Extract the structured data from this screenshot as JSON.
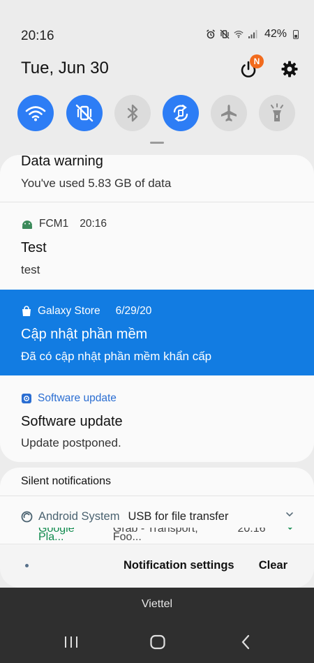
{
  "status_bar": {
    "time": "20:16",
    "battery": "42%",
    "icons": [
      "alarm-icon",
      "vibrate-icon",
      "wifi-signal-icon",
      "cell-signal-icon",
      "battery-icon"
    ]
  },
  "header": {
    "date": "Tue, Jun 30",
    "power_badge": "N"
  },
  "quick_toggles": [
    {
      "name": "wifi-icon",
      "state": "on"
    },
    {
      "name": "vibrate-icon",
      "state": "on"
    },
    {
      "name": "bluetooth-icon",
      "state": "off"
    },
    {
      "name": "auto-rotate-icon",
      "state": "on"
    },
    {
      "name": "airplane-icon",
      "state": "off"
    },
    {
      "name": "flashlight-icon",
      "state": "off"
    }
  ],
  "notifications": {
    "data_warning": {
      "title": "Data warning",
      "body": "You've used 5.83 GB of data"
    },
    "fcm": {
      "app": "FCM1",
      "time": "20:16",
      "title": "Test",
      "body": "test"
    },
    "galaxy_store": {
      "app": "Galaxy Store",
      "time": "6/29/20",
      "title": "Cập nhật phần mềm",
      "body": "Đã có cập nhật phần mềm khẩn cấp"
    },
    "software_update": {
      "app": "Software update",
      "title": "Software update",
      "body": "Update postponed."
    }
  },
  "silent": {
    "header": "Silent notifications",
    "items": [
      {
        "app": "Android System",
        "message": "USB for file transfer"
      },
      {
        "app": "Google Pla...",
        "message": "Grab - Transport, Foo...",
        "time": "20:16"
      }
    ]
  },
  "footer": {
    "settings_label": "Notification settings",
    "clear_label": "Clear"
  },
  "carrier": "Viettel",
  "colors": {
    "accent_blue": "#2d7df5",
    "highlight_blue": "#127ce2",
    "badge_orange": "#f26b1d",
    "google_green": "#0f8a4d"
  }
}
